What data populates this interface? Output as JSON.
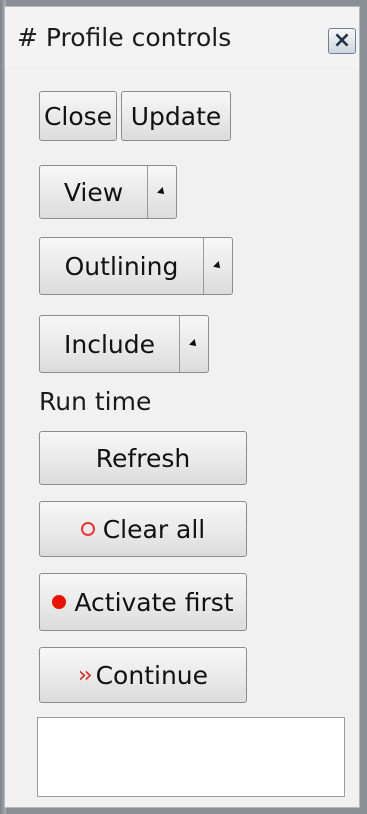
{
  "window": {
    "title": "# Profile controls"
  },
  "icons": {
    "close": "close-icon",
    "clear": "hollow-circle-icon",
    "activate": "filled-circle-icon",
    "continue": "double-chevron-icon",
    "dropdown": "dropdown-arrow-icon"
  },
  "colors": {
    "accent_red": "#ee1100"
  },
  "toolbar": {
    "close_label": "Close",
    "update_label": "Update",
    "view_label": "View",
    "outlining_label": "Outlining",
    "include_label": "Include"
  },
  "runtime": {
    "section_label": "Run time",
    "refresh_label": "Refresh",
    "clear_all_label": "Clear all",
    "activate_first_label": "Activate first",
    "continue_label": "Continue"
  },
  "output": {
    "value": ""
  }
}
